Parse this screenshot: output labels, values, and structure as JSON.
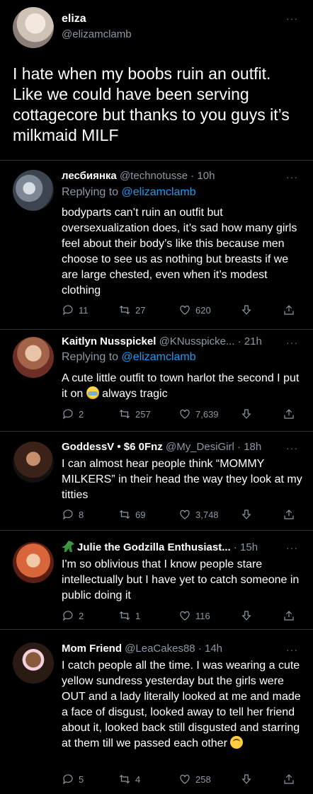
{
  "main": {
    "name": "eliza",
    "handle": "@elizamclamb",
    "text": "I hate when my boobs ruin an outfit. Like we could have been serving cottagecore but thanks to you guys it’s milkmaid MILF"
  },
  "replies": [
    {
      "name": "лесбиянка",
      "handle": "@technotusse",
      "time": "· 10h",
      "replying_prefix": "Replying to ",
      "replying_to": "@elizamclamb",
      "text": "bodyparts can’t ruin an outfit but oversexualization does, it’s sad how many girls feel about their body’s like this because men choose to see us as nothing but breasts if we are large chested, even when it’s modest clothing",
      "replies": "11",
      "retweets": "27",
      "likes": "620"
    },
    {
      "name": "Kaitlyn Nusspickel",
      "handle": "@KNusspicke...",
      "time": "· 21h",
      "replying_prefix": "Replying to ",
      "replying_to": "@elizamclamb",
      "text_before": "A cute little outfit to town harlot the second I put it on ",
      "emoji": "loudly-crying-face",
      "text_after": " always tragic",
      "replies": "2",
      "retweets": "257",
      "likes": "7,639"
    },
    {
      "name": "GoddessV • $6 0Fnz",
      "handle": "@My_DesiGirl",
      "time": "· 18h",
      "text": "I can almost hear people think “MOMMY MILKERS” in their head  the way they look at my titties",
      "replies": "8",
      "retweets": "69",
      "likes": "3,748"
    },
    {
      "name_emoji": "t-rex",
      "name": "Julie the Godzilla Enthusiast...",
      "time": "· 15h",
      "text": "I'm so oblivious that I know people stare intellectually but I have yet to catch someone in public doing it",
      "replies": "2",
      "retweets": "1",
      "likes": "116"
    },
    {
      "name": "Mom Friend",
      "handle": "@LeaCakes88",
      "time": "· 14h",
      "text": "I catch people all the time. I was wearing a cute yellow sundress yesterday but the girls were OUT and a lady literally looked at me and made a face of disgust, looked away to tell her friend about it, looked back still disgusted and starring at them till we passed each other ",
      "emoji": "upside-down-face",
      "replies": "5",
      "retweets": "4",
      "likes": "258"
    }
  ],
  "more_label": "···"
}
